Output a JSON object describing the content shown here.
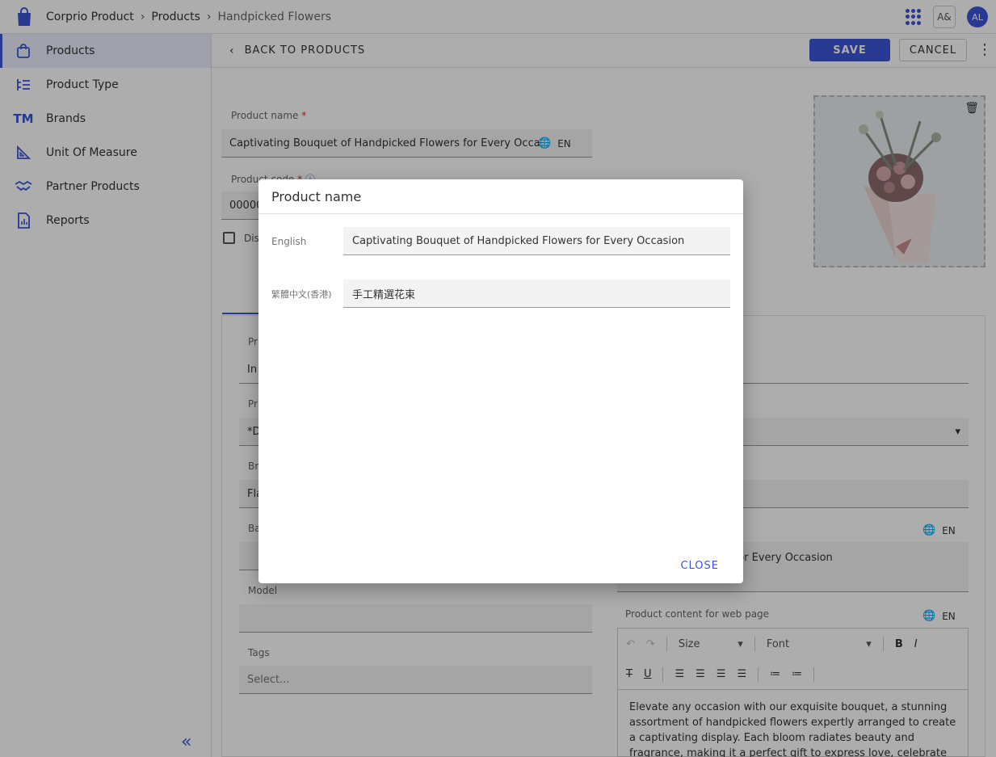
{
  "breadcrumb": [
    "Corprio Product",
    "Products",
    "Handpicked Flowers"
  ],
  "header": {
    "lang_button": "A&",
    "avatar": "AL"
  },
  "sidebar": {
    "items": [
      {
        "label": "Products",
        "icon": "shopping-bag-icon"
      },
      {
        "label": "Product Type",
        "icon": "tree-list-icon"
      },
      {
        "label": "Brands",
        "icon": "trademark-icon"
      },
      {
        "label": "Unit Of Measure",
        "icon": "set-square-icon"
      },
      {
        "label": "Partner Products",
        "icon": "handshake-icon"
      },
      {
        "label": "Reports",
        "icon": "report-icon"
      }
    ],
    "collapse": "«"
  },
  "subheader": {
    "back": "BACK TO PRODUCTS",
    "save": "SAVE",
    "cancel": "CANCEL"
  },
  "form": {
    "product_name_label": "Product name",
    "product_name_value": "Captivating Bouquet of Handpicked Flowers for Every Occa",
    "lang": "EN",
    "product_code_label": "Product code",
    "product_code_value": "00000",
    "checkbox_label": "Dis",
    "left_labels": [
      "Pr",
      "Pr",
      "Br",
      "Ba"
    ],
    "left_values": [
      "In",
      "*D",
      "Fla"
    ],
    "model_label": "Model",
    "tags_label": "Tags",
    "tags_placeholder": "Select...",
    "desc_value": "Handpicked Flowers for Every Occasion",
    "web_content_label": "Product content for web page",
    "toolbar": {
      "size": "Size",
      "font": "Font"
    },
    "web_content_text": "Elevate any occasion with our exquisite bouquet, a stunning assortment of handpicked flowers expertly arranged to create a captivating display. Each bloom radiates beauty and fragrance, making it a perfect gift to express love, celebrate a special"
  },
  "dialog": {
    "title": "Product name",
    "rows": [
      {
        "label": "English",
        "value": "Captivating Bouquet of Handpicked Flowers for Every Occasion"
      },
      {
        "label": "繁體中文(香港)",
        "value": "手工精選花束"
      }
    ],
    "close": "CLOSE"
  },
  "colors": {
    "accent": "#3a55d6"
  }
}
